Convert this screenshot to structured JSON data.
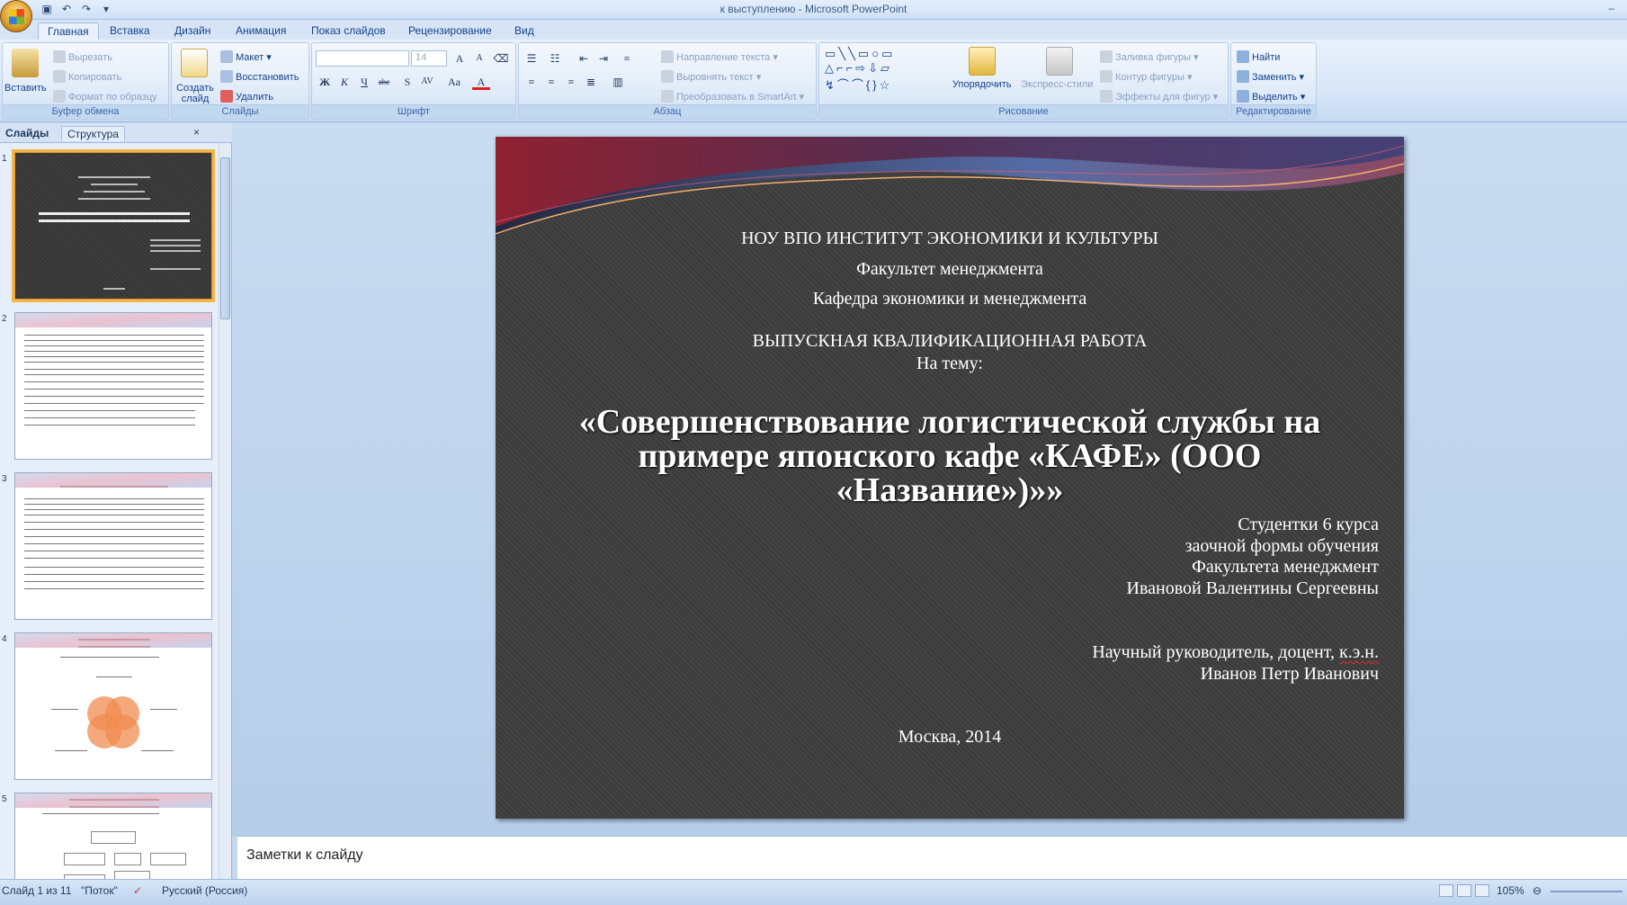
{
  "window": {
    "title": "к выступлению  -  Microsoft PowerPoint",
    "controls": "‒"
  },
  "qat": [
    "save-icon",
    "undo-icon",
    "redo-icon",
    "customize-icon"
  ],
  "ribbon_tabs": [
    "Главная",
    "Вставка",
    "Дизайн",
    "Анимация",
    "Показ слайдов",
    "Рецензирование",
    "Вид"
  ],
  "ribbon": {
    "clipboard": {
      "label": "Буфер обмена",
      "paste": "Вставить",
      "cut": "Вырезать",
      "copy": "Копировать",
      "format_painter": "Формат по образцу"
    },
    "slides": {
      "label": "Слайды",
      "new_slide": "Создать слайд",
      "layout": "Макет",
      "reset": "Восстановить",
      "delete": "Удалить"
    },
    "font": {
      "label": "Шрифт",
      "font_name": "",
      "font_size": "14"
    },
    "paragraph": {
      "label": "Абзац",
      "text_direction": "Направление текста",
      "align_text": "Выровнять текст",
      "smartart": "Преобразовать в SmartArt"
    },
    "drawing": {
      "label": "Рисование",
      "arrange": "Упорядочить",
      "quick_styles": "Экспресс-стили",
      "shape_fill": "Заливка фигуры",
      "shape_outline": "Контур фигуры",
      "shape_effects": "Эффекты для фигур"
    },
    "editing": {
      "label": "Редактирование",
      "find": "Найти",
      "replace": "Заменить",
      "select": "Выделить"
    }
  },
  "left_pane": {
    "tabs": [
      "Слайды",
      "Структура"
    ],
    "close": "×",
    "thumbnail_numbers": [
      "1",
      "2",
      "3",
      "4",
      "5"
    ]
  },
  "slide": {
    "line1": "НОУ ВПО ИНСТИТУТ ЭКОНОМИКИ И КУЛЬТУРЫ",
    "line2": "Факультет менеджмента",
    "line3": "Кафедра экономики и менеджмента",
    "line4": "ВЫПУСКНАЯ КВАЛИФИКАЦИОННАЯ РАБОТА",
    "line5": "На тему:",
    "title_line1": "«Совершенствование логистической службы на",
    "title_line2": "примере японского кафе «КАФЕ» (ООО «Название»)»»",
    "student1": "Студентки 6 курса",
    "student2": "заочной формы обучения",
    "student3": "Факультета менеджмент",
    "student4": "Ивановой Валентины Сергеевны",
    "supervisor1_a": "Научный руководитель, доцент, ",
    "supervisor1_b": "к.э.н.",
    "supervisor2": "Иванов Петр Иванович",
    "city_year": "Москва, 2014"
  },
  "notes": {
    "placeholder": "Заметки к слайду"
  },
  "status": {
    "slide_counter": "Слайд 1 из 11",
    "theme": "\"Поток\"",
    "language": "Русский (Россия)",
    "zoom": "105%"
  }
}
